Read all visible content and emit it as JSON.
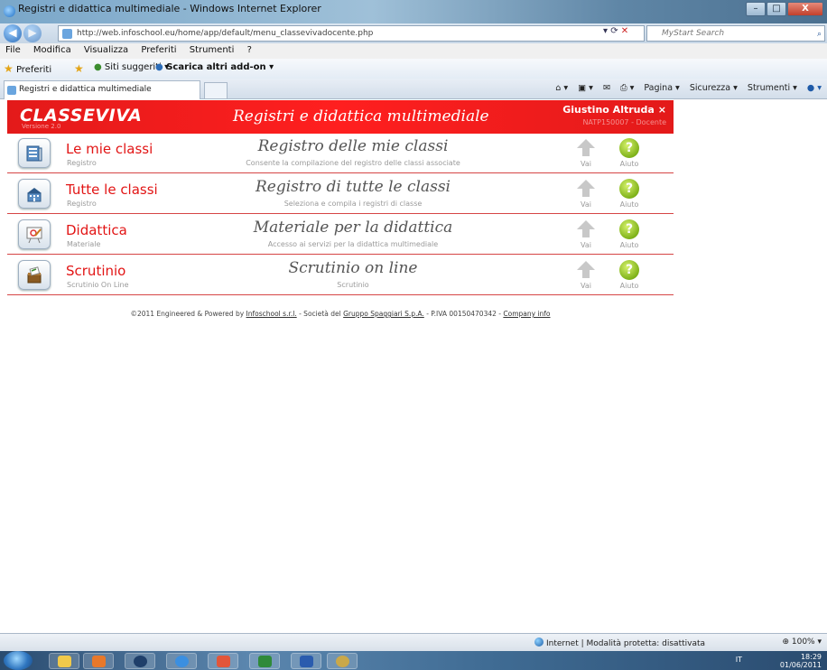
{
  "window": {
    "title": "Registri e didattica multimediale - Windows Internet Explorer",
    "minimize": "–",
    "maximize": "□",
    "close": "X"
  },
  "addressbar": {
    "url": "http://web.infoschool.eu/home/app/default/menu_classevivadocente.php",
    "search_placeholder": "MyStart Search"
  },
  "menubar": [
    "File",
    "Modifica",
    "Visualizza",
    "Preferiti",
    "Strumenti",
    "?"
  ],
  "favorites": {
    "preferiti": "Preferiti",
    "siti_suggeriti": "Siti suggeriti ▾",
    "scarica": "Scarica altri add-on ▾"
  },
  "tab": {
    "title": "Registri e didattica multimediale"
  },
  "commandbar": [
    "Pagina ▾",
    "Sicurezza ▾",
    "Strumenti ▾"
  ],
  "header": {
    "logo": "CLASSEVIVA",
    "version": "Versione 2.0",
    "app_title": "Registri e didattica multimediale",
    "user_name": "Giustino Altruda",
    "user_close": "×",
    "user_info": "NATP150007 - Docente"
  },
  "rows": [
    {
      "title": "Le mie classi",
      "subtitle": "Registro",
      "center": "Registro delle mie classi",
      "description": "Consente la compilazione del registro delle classi associate",
      "go": "Vai",
      "help": "Aiuto",
      "icon": "register-icon"
    },
    {
      "title": "Tutte le classi",
      "subtitle": "Registro",
      "center": "Registro di tutte le classi",
      "description": "Seleziona e compila i registri di classe",
      "go": "Vai",
      "help": "Aiuto",
      "icon": "school-icon"
    },
    {
      "title": "Didattica",
      "subtitle": "Materiale",
      "center": "Materiale per la didattica",
      "description": "Accesso ai servizi per la didattica multimediale",
      "go": "Vai",
      "help": "Aiuto",
      "icon": "whiteboard-icon"
    },
    {
      "title": "Scrutinio",
      "subtitle": "Scrutinio On Line",
      "center": "Scrutinio on line",
      "description": "Scrutinio",
      "go": "Vai",
      "help": "Aiuto",
      "icon": "ballot-box-icon"
    }
  ],
  "footer": {
    "text1": "©2011 Engineered & Powered by ",
    "infoschool": "Infoschool s.r.l.",
    "text2": " - Società del ",
    "gruppo": "Gruppo Spaggiari S.p.A.",
    "text3": " - P.IVA 00150470342 - ",
    "company_info": "Company info"
  },
  "statusbar": {
    "zone": "Internet | Modalità protetta: disattivata",
    "zoom": "100%"
  },
  "taskbar": {
    "lang": "IT",
    "time": "18:29",
    "date": "01/06/2011"
  },
  "colors": {
    "brand_red": "#ff1f1f",
    "title_red": "#e21515",
    "help_green": "#7fb21a"
  }
}
